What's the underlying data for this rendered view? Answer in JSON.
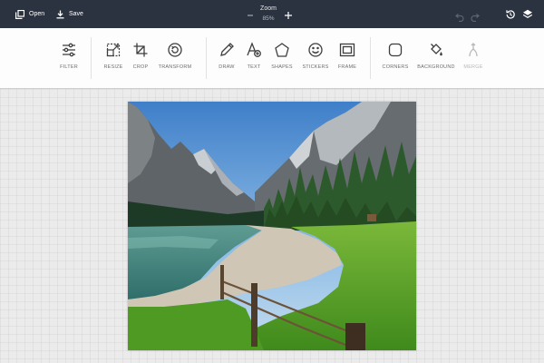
{
  "topbar": {
    "open_label": "Open",
    "save_label": "Save",
    "zoom_label": "Zoom",
    "zoom_value": "85%"
  },
  "toolbar": {
    "tools": [
      {
        "label": "FILTER",
        "icon": "sliders-icon"
      },
      {
        "label": "RESIZE",
        "icon": "resize-icon"
      },
      {
        "label": "CROP",
        "icon": "crop-icon"
      },
      {
        "label": "TRANSFORM",
        "icon": "rotate-icon"
      },
      {
        "label": "DRAW",
        "icon": "pencil-icon"
      },
      {
        "label": "TEXT",
        "icon": "text-icon"
      },
      {
        "label": "SHAPES",
        "icon": "pentagon-icon"
      },
      {
        "label": "STICKERS",
        "icon": "smiley-icon"
      },
      {
        "label": "FRAME",
        "icon": "frame-icon"
      },
      {
        "label": "CORNERS",
        "icon": "rounded-square-icon"
      },
      {
        "label": "BACKGROUND",
        "icon": "paint-bucket-icon"
      },
      {
        "label": "MERGE",
        "icon": "merge-icon"
      }
    ]
  },
  "colors": {
    "topbar_bg": "#2b3340",
    "canvas_bg": "#ebebeb",
    "icon": "#3d3d3d",
    "disabled": "#b8b8b8"
  }
}
